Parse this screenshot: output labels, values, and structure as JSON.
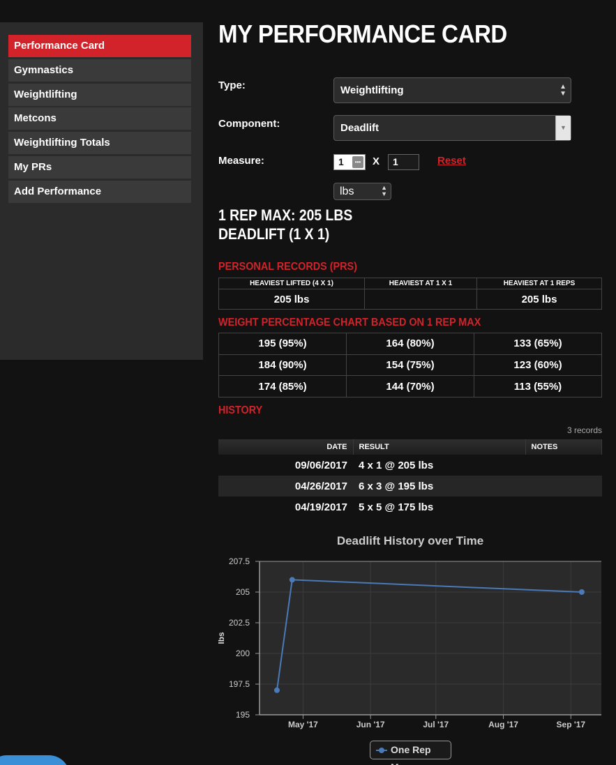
{
  "sidebar": {
    "items": [
      {
        "label": "Performance Card",
        "active": true
      },
      {
        "label": "Gymnastics"
      },
      {
        "label": "Weightlifting"
      },
      {
        "label": "Metcons"
      },
      {
        "label": "Weightlifting Totals"
      },
      {
        "label": "My PRs"
      },
      {
        "label": "Add Performance"
      }
    ]
  },
  "page": {
    "title": "MY PERFORMANCE CARD"
  },
  "form": {
    "type_label": "Type:",
    "type_value": "Weightlifting",
    "component_label": "Component:",
    "component_value": "Deadlift",
    "measure_label": "Measure:",
    "sets_value": "1",
    "times_symbol": "X",
    "reps_value": "1",
    "reset_label": "Reset",
    "unit_value": "lbs"
  },
  "summary": {
    "line1": "1 REP MAX: 205 LBS",
    "line2": "DEADLIFT (1 X 1)"
  },
  "prs": {
    "title": "PERSONAL RECORDS (PRS)",
    "headers": [
      "HEAVIEST LIFTED (4 X 1)",
      "HEAVIEST AT 1 X 1",
      "HEAVIEST AT 1 REPS"
    ],
    "values": [
      "205 lbs",
      "",
      "205 lbs"
    ]
  },
  "percentages": {
    "title": "WEIGHT PERCENTAGE CHART BASED ON 1 REP MAX",
    "rows": [
      [
        "195 (95%)",
        "164 (80%)",
        "133 (65%)"
      ],
      [
        "184 (90%)",
        "154 (75%)",
        "123 (60%)"
      ],
      [
        "174 (85%)",
        "144 (70%)",
        "113 (55%)"
      ]
    ]
  },
  "history": {
    "title": "HISTORY",
    "records_count": "3 records",
    "headers": {
      "date": "DATE",
      "result": "RESULT",
      "notes": "NOTES"
    },
    "rows": [
      {
        "date": "09/06/2017",
        "result": "4 x 1 @ 205 lbs",
        "notes": ""
      },
      {
        "date": "04/26/2017",
        "result": "6 x 3 @ 195 lbs",
        "notes": ""
      },
      {
        "date": "04/19/2017",
        "result": "5 x 5 @ 175 lbs",
        "notes": ""
      }
    ]
  },
  "chart_data": {
    "type": "line",
    "title": "Deadlift History over Time",
    "ylabel": "lbs",
    "xlabel": "",
    "ylim": [
      195,
      207.5
    ],
    "xlim": [
      "2017-04-11",
      "2017-09-15"
    ],
    "yticks": [
      "195",
      "197.5",
      "200",
      "202.5",
      "205",
      "207.5"
    ],
    "xticks": [
      {
        "label": "May '17",
        "date": "2017-05-01"
      },
      {
        "label": "Jun '17",
        "date": "2017-06-01"
      },
      {
        "label": "Jul '17",
        "date": "2017-07-01"
      },
      {
        "label": "Aug '17",
        "date": "2017-08-01"
      },
      {
        "label": "Sep '17",
        "date": "2017-09-01"
      }
    ],
    "grid": true,
    "legend": "bottom",
    "series": [
      {
        "name": "One Rep Max",
        "color": "#4a7ab8",
        "points": [
          {
            "x": "2017-04-19",
            "y": 197
          },
          {
            "x": "2017-04-26",
            "y": 206
          },
          {
            "x": "2017-09-06",
            "y": 205
          }
        ]
      }
    ]
  }
}
